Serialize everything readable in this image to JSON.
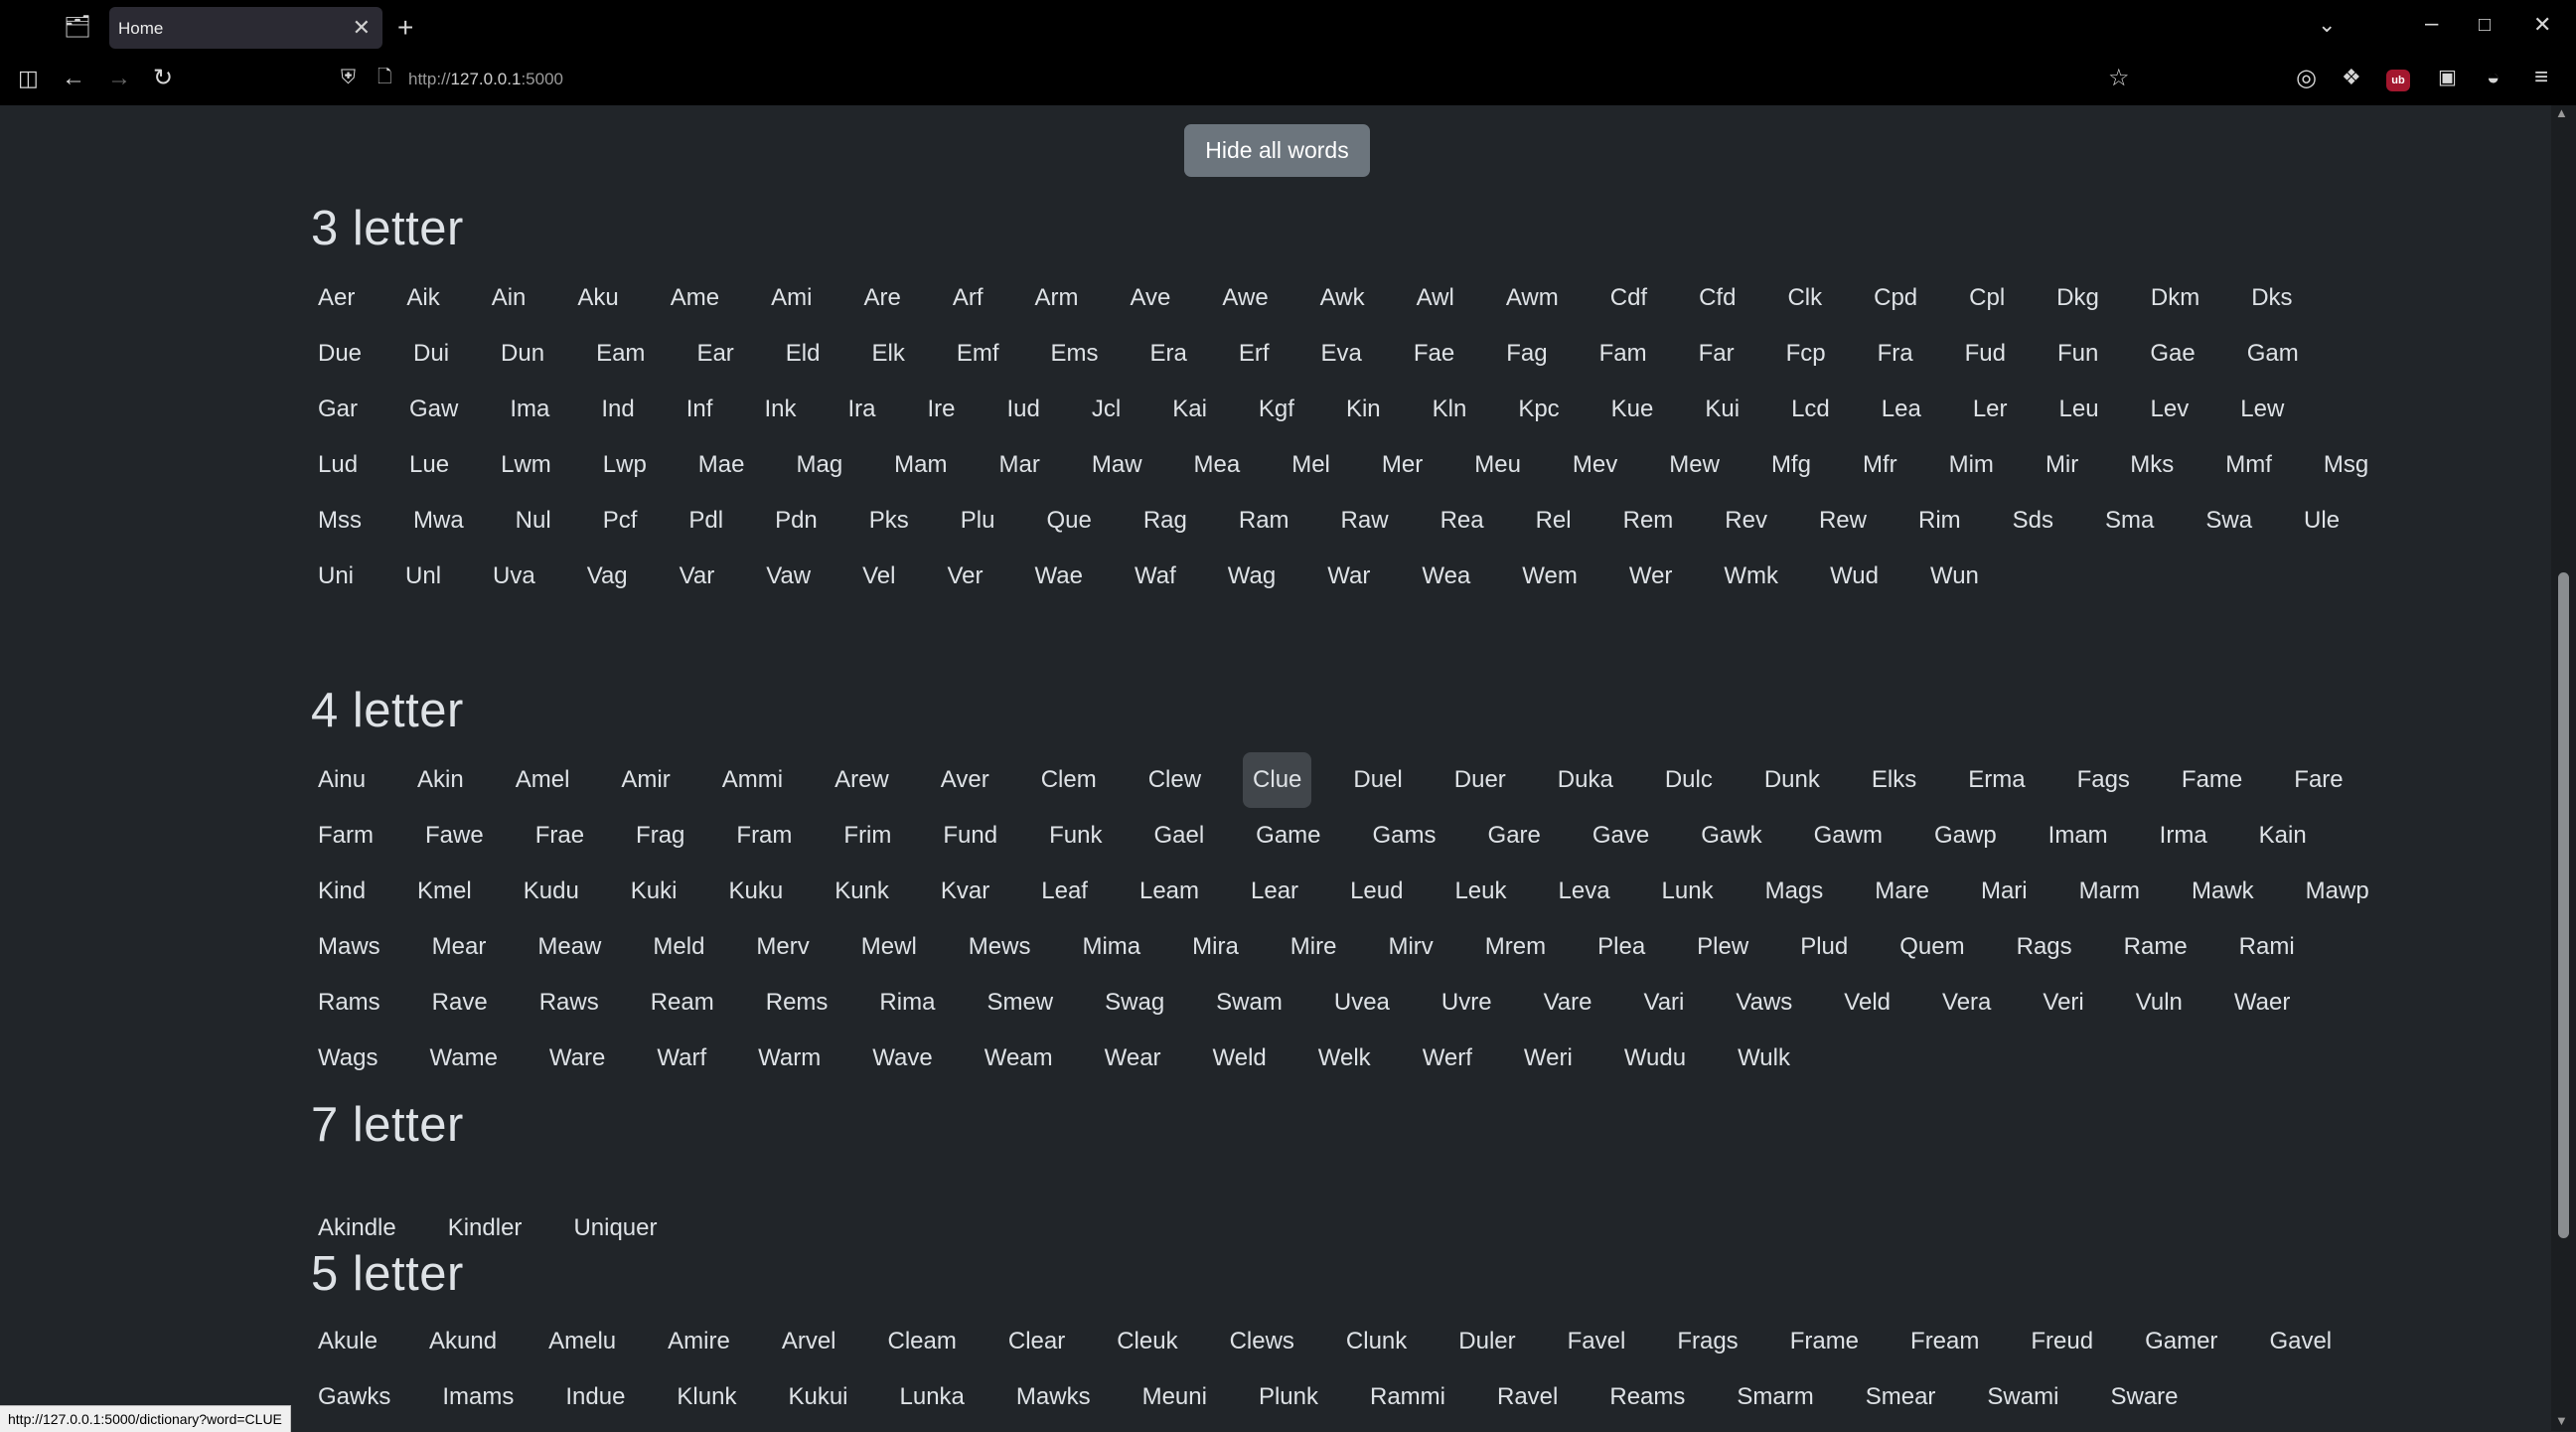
{
  "browser": {
    "tab_title": "Home",
    "url_scheme": "http://",
    "url_host": "127.0.0.1",
    "url_port": ":5000",
    "status_url": "http://127.0.0.1:5000/dictionary?word=CLUE"
  },
  "toolbar": {
    "hide_all_label": "Hide all words"
  },
  "sections": [
    {
      "heading": "3 letter",
      "words": [
        "Aer",
        "Aik",
        "Ain",
        "Aku",
        "Ame",
        "Ami",
        "Are",
        "Arf",
        "Arm",
        "Ave",
        "Awe",
        "Awk",
        "Awl",
        "Awm",
        "Cdf",
        "Cfd",
        "Clk",
        "Cpd",
        "Cpl",
        "Dkg",
        "Dkm",
        "Dks",
        "Due",
        "Dui",
        "Dun",
        "Eam",
        "Ear",
        "Eld",
        "Elk",
        "Emf",
        "Ems",
        "Era",
        "Erf",
        "Eva",
        "Fae",
        "Fag",
        "Fam",
        "Far",
        "Fcp",
        "Fra",
        "Fud",
        "Fun",
        "Gae",
        "Gam",
        "Gar",
        "Gaw",
        "Ima",
        "Ind",
        "Inf",
        "Ink",
        "Ira",
        "Ire",
        "Iud",
        "Jcl",
        "Kai",
        "Kgf",
        "Kin",
        "Kln",
        "Kpc",
        "Kue",
        "Kui",
        "Lcd",
        "Lea",
        "Ler",
        "Leu",
        "Lev",
        "Lew",
        "Lud",
        "Lue",
        "Lwm",
        "Lwp",
        "Mae",
        "Mag",
        "Mam",
        "Mar",
        "Maw",
        "Mea",
        "Mel",
        "Mer",
        "Meu",
        "Mev",
        "Mew",
        "Mfg",
        "Mfr",
        "Mim",
        "Mir",
        "Mks",
        "Mmf",
        "Msg",
        "Mss",
        "Mwa",
        "Nul",
        "Pcf",
        "Pdl",
        "Pdn",
        "Pks",
        "Plu",
        "Que",
        "Rag",
        "Ram",
        "Raw",
        "Rea",
        "Rel",
        "Rem",
        "Rev",
        "Rew",
        "Rim",
        "Sds",
        "Sma",
        "Swa",
        "Ule",
        "Uni",
        "Unl",
        "Uva",
        "Vag",
        "Var",
        "Vaw",
        "Vel",
        "Ver",
        "Wae",
        "Waf",
        "Wag",
        "War",
        "Wea",
        "Wem",
        "Wer",
        "Wmk",
        "Wud",
        "Wun"
      ]
    },
    {
      "heading": "4 letter",
      "words": [
        "Ainu",
        "Akin",
        "Amel",
        "Amir",
        "Ammi",
        "Arew",
        "Aver",
        "Clem",
        "Clew",
        "Clue",
        "Duel",
        "Duer",
        "Duka",
        "Dulc",
        "Dunk",
        "Elks",
        "Erma",
        "Fags",
        "Fame",
        "Fare",
        "Farm",
        "Fawe",
        "Frae",
        "Frag",
        "Fram",
        "Frim",
        "Fund",
        "Funk",
        "Gael",
        "Game",
        "Gams",
        "Gare",
        "Gave",
        "Gawk",
        "Gawm",
        "Gawp",
        "Imam",
        "Irma",
        "Kain",
        "Kind",
        "Kmel",
        "Kudu",
        "Kuki",
        "Kuku",
        "Kunk",
        "Kvar",
        "Leaf",
        "Leam",
        "Lear",
        "Leud",
        "Leuk",
        "Leva",
        "Lunk",
        "Mags",
        "Mare",
        "Mari",
        "Marm",
        "Mawk",
        "Mawp",
        "Maws",
        "Mear",
        "Meaw",
        "Meld",
        "Merv",
        "Mewl",
        "Mews",
        "Mima",
        "Mira",
        "Mire",
        "Mirv",
        "Mrem",
        "Plea",
        "Plew",
        "Plud",
        "Quem",
        "Rags",
        "Rame",
        "Rami",
        "Rams",
        "Rave",
        "Raws",
        "Ream",
        "Rems",
        "Rima",
        "Smew",
        "Swag",
        "Swam",
        "Uvea",
        "Uvre",
        "Vare",
        "Vari",
        "Vaws",
        "Veld",
        "Vera",
        "Veri",
        "Vuln",
        "Waer",
        "Wags",
        "Wame",
        "Ware",
        "Warf",
        "Warm",
        "Wave",
        "Weam",
        "Wear",
        "Weld",
        "Welk",
        "Werf",
        "Weri",
        "Wudu",
        "Wulk"
      ]
    },
    {
      "heading": "7 letter",
      "words": [
        "Akindle",
        "Kindler",
        "Uniquer"
      ]
    },
    {
      "heading": "5 letter",
      "words": [
        "Akule",
        "Akund",
        "Amelu",
        "Amire",
        "Arvel",
        "Cleam",
        "Clear",
        "Cleuk",
        "Clews",
        "Clunk",
        "Duler",
        "Favel",
        "Frags",
        "Frame",
        "Fream",
        "Freud",
        "Gamer",
        "Gavel",
        "Gawks",
        "Imams",
        "Indue",
        "Klunk",
        "Kukui",
        "Lunka",
        "Mawks",
        "Meuni",
        "Plunk",
        "Rammi",
        "Ravel",
        "Reams",
        "Smarm",
        "Smear",
        "Swami",
        "Sware"
      ]
    }
  ],
  "hovered_word": "Clue"
}
